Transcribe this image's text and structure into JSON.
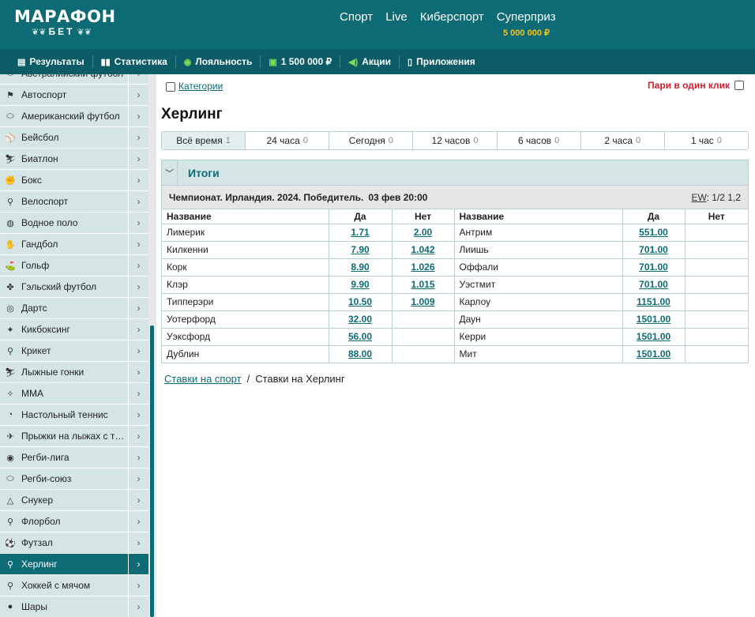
{
  "header": {
    "logo_main": "МАРАФОН",
    "logo_sub": "БЕТ",
    "nav": [
      {
        "label": "Спорт"
      },
      {
        "label": "Live"
      },
      {
        "label": "Киберспорт"
      },
      {
        "label": "Суперприз"
      }
    ],
    "superprize_amount": "5 000 000 ₽"
  },
  "subnav": [
    {
      "label": "Результаты",
      "icon": "results-icon"
    },
    {
      "label": "Статистика",
      "icon": "stats-icon"
    },
    {
      "label": "Лояльность",
      "icon": "loyalty-icon"
    },
    {
      "label": "1 500 000 ₽",
      "icon": "prize-icon"
    },
    {
      "label": "Акции",
      "icon": "megaphone-icon"
    },
    {
      "label": "Приложения",
      "icon": "phone-icon"
    }
  ],
  "sidebar": {
    "items": [
      {
        "label": "Австралийский футбол",
        "icon": "australian-football-icon"
      },
      {
        "label": "Автоспорт",
        "icon": "motorsport-icon"
      },
      {
        "label": "Американский футбол",
        "icon": "american-football-icon"
      },
      {
        "label": "Бейсбол",
        "icon": "baseball-icon"
      },
      {
        "label": "Биатлон",
        "icon": "biathlon-icon"
      },
      {
        "label": "Бокс",
        "icon": "boxing-icon"
      },
      {
        "label": "Велоспорт",
        "icon": "cycling-icon"
      },
      {
        "label": "Водное поло",
        "icon": "water-polo-icon"
      },
      {
        "label": "Гандбол",
        "icon": "handball-icon"
      },
      {
        "label": "Гольф",
        "icon": "golf-icon"
      },
      {
        "label": "Гэльский футбол",
        "icon": "gaelic-football-icon"
      },
      {
        "label": "Дартс",
        "icon": "darts-icon"
      },
      {
        "label": "Кикбоксинг",
        "icon": "kickboxing-icon"
      },
      {
        "label": "Крикет",
        "icon": "cricket-icon"
      },
      {
        "label": "Лыжные гонки",
        "icon": "skiing-icon"
      },
      {
        "label": "MMA",
        "icon": "mma-icon"
      },
      {
        "label": "Настольный теннис",
        "icon": "table-tennis-icon"
      },
      {
        "label": "Прыжки на лыжах с т…",
        "icon": "ski-jumping-icon"
      },
      {
        "label": "Регби-лига",
        "icon": "rugby-league-icon"
      },
      {
        "label": "Регби-союз",
        "icon": "rugby-union-icon"
      },
      {
        "label": "Снукер",
        "icon": "snooker-icon"
      },
      {
        "label": "Флорбол",
        "icon": "floorball-icon"
      },
      {
        "label": "Футзал",
        "icon": "futsal-icon"
      },
      {
        "label": "Херлинг",
        "icon": "hurling-icon",
        "active": true
      },
      {
        "label": "Хоккей с мячом",
        "icon": "bandy-icon"
      },
      {
        "label": "Шары",
        "icon": "bowls-icon"
      }
    ]
  },
  "main": {
    "categories_label": "Категории",
    "one_click_label": "Пари в один клик",
    "title": "Херлинг",
    "time_filters": [
      {
        "label": "Всё время",
        "count": "1"
      },
      {
        "label": "24 часа",
        "count": "0"
      },
      {
        "label": "Сегодня",
        "count": "0"
      },
      {
        "label": "12 часов",
        "count": "0"
      },
      {
        "label": "6 часов",
        "count": "0"
      },
      {
        "label": "2 часа",
        "count": "0"
      },
      {
        "label": "1 час",
        "count": "0"
      }
    ],
    "section_title": "Итоги",
    "event": {
      "name": "Чемпионат. Ирландия. 2024. Победитель.",
      "time": "03 фев 20:00",
      "ew_label": "EW",
      "ew_value": ": 1/2 1,2"
    },
    "table_headers": [
      "Название",
      "Да",
      "Нет",
      "Название",
      "Да",
      "Нет"
    ],
    "rows": [
      {
        "n1": "Лимерик",
        "y1": "1.71",
        "no1": "2.00",
        "n2": "Антрим",
        "y2": "551.00",
        "no2": ""
      },
      {
        "n1": "Килкенни",
        "y1": "7.90",
        "no1": "1.042",
        "n2": "Лиишь",
        "y2": "701.00",
        "no2": ""
      },
      {
        "n1": "Корк",
        "y1": "8.90",
        "no1": "1.026",
        "n2": "Оффали",
        "y2": "701.00",
        "no2": ""
      },
      {
        "n1": "Клэр",
        "y1": "9.90",
        "no1": "1.015",
        "n2": "Уэстмит",
        "y2": "701.00",
        "no2": ""
      },
      {
        "n1": "Типперэри",
        "y1": "10.50",
        "no1": "1.009",
        "n2": "Карлоу",
        "y2": "1151.00",
        "no2": ""
      },
      {
        "n1": "Уотерфорд",
        "y1": "32.00",
        "no1": "",
        "n2": "Даун",
        "y2": "1501.00",
        "no2": ""
      },
      {
        "n1": "Уэксфорд",
        "y1": "56.00",
        "no1": "",
        "n2": "Керри",
        "y2": "1501.00",
        "no2": ""
      },
      {
        "n1": "Дублин",
        "y1": "88.00",
        "no1": "",
        "n2": "Мит",
        "y2": "1501.00",
        "no2": ""
      }
    ],
    "breadcrumbs": {
      "link": "Ставки на спорт",
      "separator": "/",
      "current": "Ставки на Херлинг"
    }
  },
  "colors": {
    "brand": "#0d6b75",
    "accent_gold": "#f5c518",
    "alert_red": "#d02030"
  }
}
